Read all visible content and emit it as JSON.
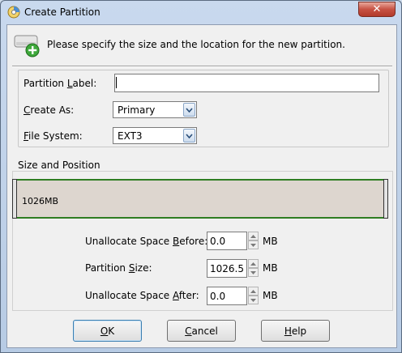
{
  "window": {
    "title": "Create Partition",
    "close_glyph": "✕"
  },
  "header": {
    "text": "Please specify the size and the location for the new partition.",
    "icon": "disk-add-icon"
  },
  "form": {
    "partition_label": {
      "label_pre": "Partition ",
      "label_u": "L",
      "label_post": "abel:",
      "value": ""
    },
    "create_as": {
      "label_pre": "",
      "label_u": "C",
      "label_post": "reate As:",
      "value": "Primary"
    },
    "file_system": {
      "label_pre": "",
      "label_u": "F",
      "label_post": "ile System:",
      "value": "EXT3"
    }
  },
  "size_position": {
    "title": "Size and Position",
    "bar_text": "1026MB",
    "before": {
      "label_pre": "Unallocate Space ",
      "label_u": "B",
      "label_post": "efore:",
      "value": "0.0",
      "unit": "MB"
    },
    "size": {
      "label_pre": "Partition ",
      "label_u": "S",
      "label_post": "ize:",
      "value": "1026.5",
      "unit": "MB"
    },
    "after": {
      "label_pre": "Unallocate Space ",
      "label_u": "A",
      "label_post": "fter:",
      "value": "0.0",
      "unit": "MB"
    }
  },
  "buttons": {
    "ok": {
      "u": "O",
      "rest": "K"
    },
    "cancel": {
      "u": "C",
      "rest": "ancel"
    },
    "help": {
      "u": "H",
      "rest": "elp"
    }
  },
  "colors": {
    "bar_border": "#2e7d22",
    "bar_fill": "#ddd6cf",
    "close": "#c75243"
  }
}
